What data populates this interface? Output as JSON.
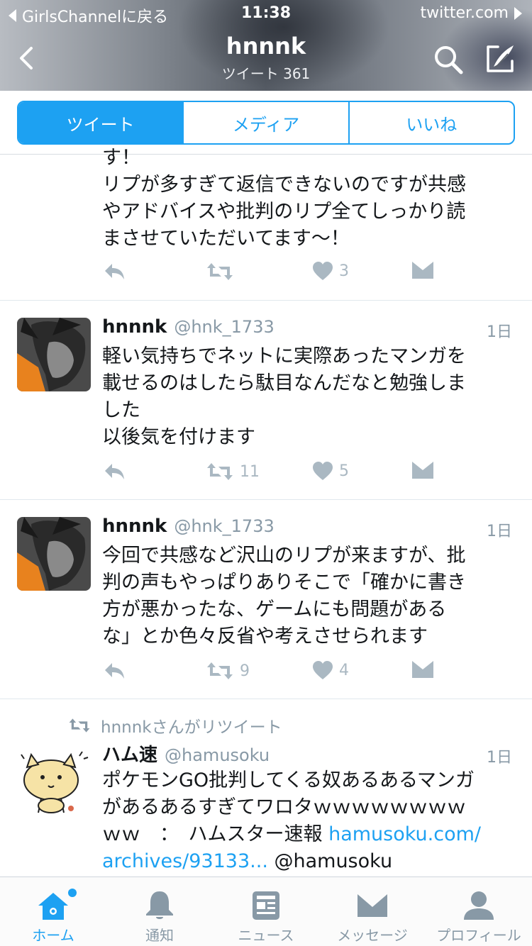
{
  "status_bar": {
    "back_app": "GirlsChannelに戻る",
    "time": "11:38",
    "host": "twitter.com"
  },
  "header": {
    "name": "hnnnk",
    "subtitle": "ツイート 361"
  },
  "segments": [
    "ツイート",
    "メディア",
    "いいね"
  ],
  "tweets": [
    {
      "partial_top": "す！",
      "text": "リプが多すぎて返信できないのですが共感\nやアドバイスや批判のリプ全てしっかり読\nまさせていただいてます〜！",
      "retweets": "",
      "likes": "3"
    },
    {
      "name": "hnnnk",
      "handle": "@hnk_1733",
      "time": "1日",
      "text": "軽い気持ちでネットに実際あったマンガを\n載せるのはしたら駄目なんだなと勉強しま\nした\n以後気を付けます",
      "retweets": "11",
      "likes": "5"
    },
    {
      "name": "hnnnk",
      "handle": "@hnk_1733",
      "time": "1日",
      "text": "今回で共感など沢山のリプが来ますが、批\n判の声もやっぱりありそこで「確かに書き\n方が悪かったな、ゲームにも問題がある\nな」とか色々反省や考えさせられます",
      "retweets": "9",
      "likes": "4"
    },
    {
      "retweeted_by": "hnnnkさんがリツイート",
      "name": "ハム速",
      "handle": "@hamusoku",
      "time": "1日",
      "text": "ポケモンGO批判してくる奴あるあるマンガ\nがあるあるすぎてワロタｗｗｗｗｗｗｗｗ\nｗｗ　：　ハムスター速報 ",
      "link1": "hamusoku.com/",
      "link2": "archives/93133...",
      "text_tail": " @hamusoku"
    }
  ],
  "tabbar": [
    "ホーム",
    "通知",
    "ニュース",
    "メッセージ",
    "プロフィール"
  ],
  "colors": {
    "accent": "#1da1f2",
    "muted": "#8899a6",
    "icon": "#aab8c2"
  }
}
